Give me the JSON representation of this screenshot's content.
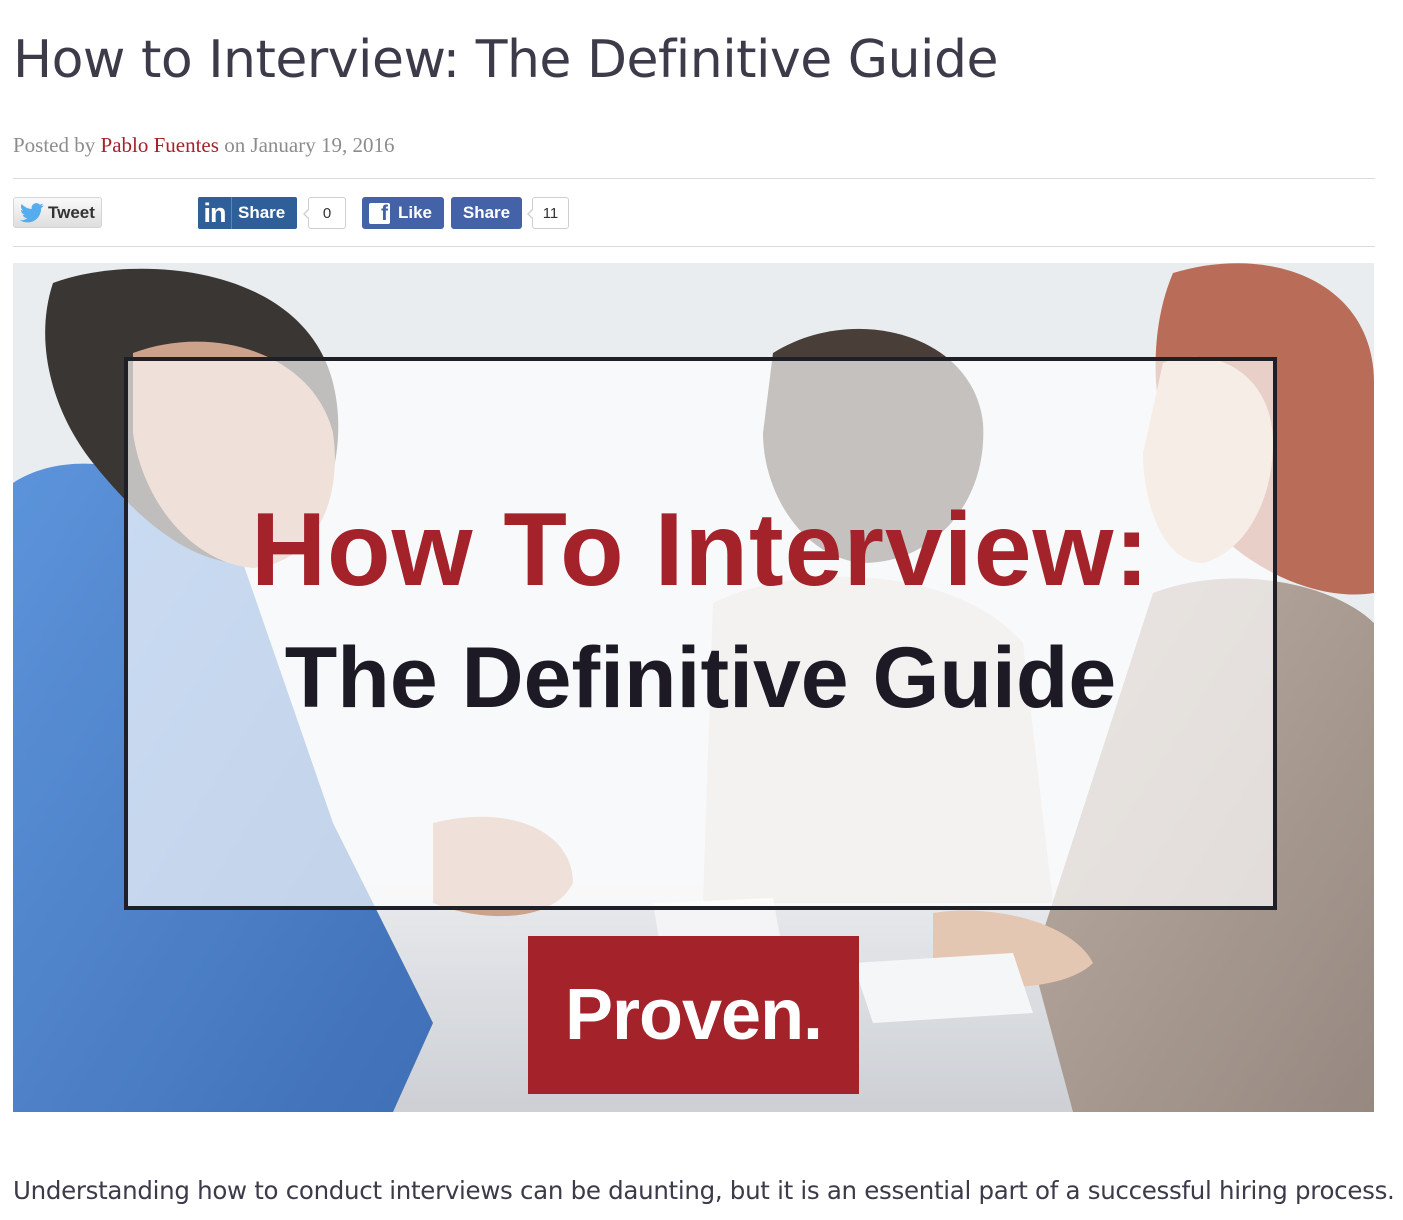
{
  "post": {
    "title": "How to Interview: The Definitive Guide",
    "byline": {
      "prefix": "Posted by",
      "author": "Pablo Fuentes",
      "on": "on",
      "date": "January 19, 2016"
    }
  },
  "share_bar": {
    "tweet_label": "Tweet",
    "linkedin": {
      "label": "Share",
      "count": "0"
    },
    "facebook": {
      "like_label": "Like",
      "share_label": "Share",
      "count": "11"
    }
  },
  "hero": {
    "line1": "How To Interview:",
    "line2": "The Definitive Guide",
    "logo": "Proven."
  },
  "intro_text": "Understanding how to conduct interviews can be daunting, but it is an essential part of a successful hiring process.",
  "colors": {
    "brand_red": "#a4222a",
    "title_text": "#3d3a4a",
    "linkedin_blue": "#2f5f99",
    "facebook_blue": "#4462a8",
    "twitter_blue": "#55acee"
  },
  "icons": [
    "twitter-bird-icon",
    "linkedin-icon",
    "facebook-icon"
  ]
}
